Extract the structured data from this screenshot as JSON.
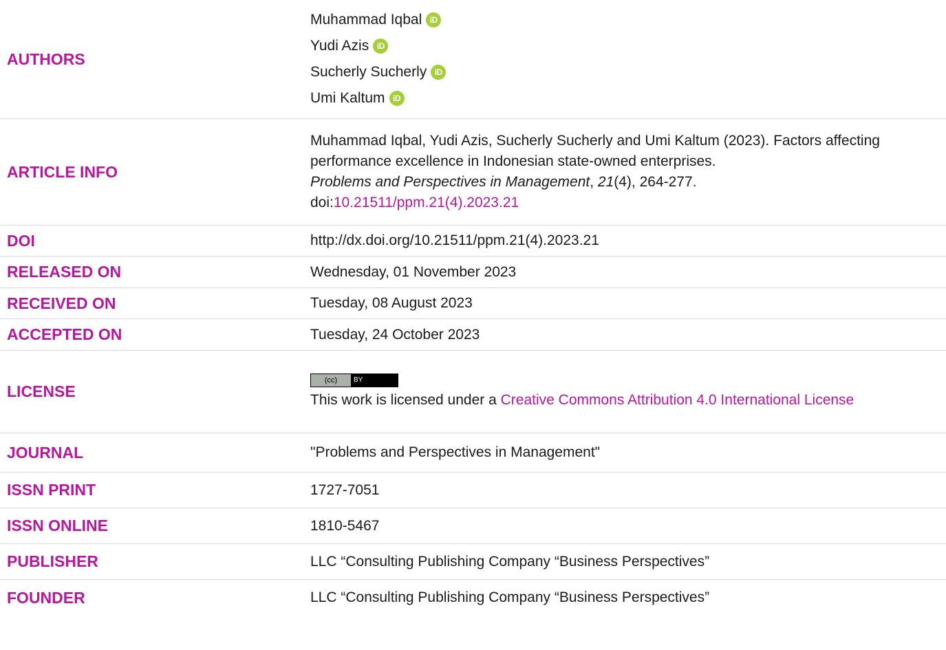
{
  "authors": {
    "label": "AUTHORS",
    "names": [
      "Muhammad Iqbal",
      "Yudi Azis",
      "Sucherly Sucherly",
      "Umi Kaltum"
    ],
    "orcid_icon_text": "iD",
    "orcid_color": "#a6ce39"
  },
  "article_info": {
    "label": "ARTICLE INFO",
    "line1": "Muhammad Iqbal, Yudi Azis, Sucherly Sucherly and Umi Kaltum (2023). Factors affecting performance excellence in Indonesian state-owned enterprises.",
    "journal": "Problems and Perspectives in Management",
    "sep1": ", ",
    "volume": "21",
    "issue_pages": "(4), 264-277.",
    "doi_prefix": "doi:",
    "doi_link": "10.21511/ppm.21(4).2023.21"
  },
  "doi": {
    "label": "DOI",
    "value": "http://dx.doi.org/10.21511/ppm.21(4).2023.21"
  },
  "released": {
    "label": "RELEASED ON",
    "value": "Wednesday, 01 November 2023"
  },
  "received": {
    "label": "RECEIVED ON",
    "value": "Tuesday, 08 August 2023"
  },
  "accepted": {
    "label": "ACCEPTED ON",
    "value": "Tuesday, 24 October 2023"
  },
  "license": {
    "label": "LICENSE",
    "badge_cc": "(cc)",
    "badge_by": "BY",
    "text_prefix": "This work is licensed under a ",
    "link_text": "Creative Commons Attribution 4.0 International License"
  },
  "journal": {
    "label": "JOURNAL",
    "value": "\"Problems and Perspectives in Management\""
  },
  "issn_print": {
    "label": "ISSN PRINT",
    "value": "1727-7051"
  },
  "issn_online": {
    "label": "ISSN ONLINE",
    "value": "1810-5467"
  },
  "publisher": {
    "label": "PUBLISHER",
    "value": "LLC “Consulting Publishing Company “Business Perspectives”"
  },
  "founder": {
    "label": "FOUNDER",
    "value": "LLC “Consulting Publishing Company “Business Perspectives”"
  },
  "colors": {
    "accent": "#b5179e",
    "text": "#1a1a1a",
    "divider": "#d9d9d9"
  }
}
